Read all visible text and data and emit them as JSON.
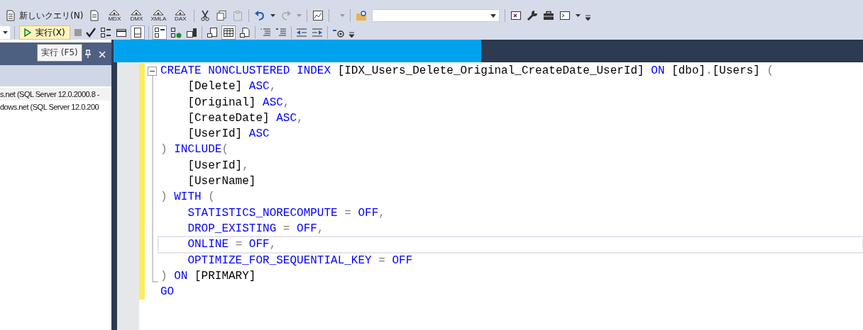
{
  "toolbar_main": {
    "new_query_button": "新しいクエリ(N)",
    "query_type_buttons": [
      "MDX",
      "DMX",
      "XMLA",
      "DAX"
    ]
  },
  "toolbar_sql": {
    "execute_button": "実行(X)"
  },
  "tooltip": "実行 (F5)",
  "object_explorer": {
    "items": [
      {
        "text": "s.net (SQL Server 12.0.2000.8 -",
        "selected": true
      },
      {
        "text": "dows.net (SQL Server 12.0.200",
        "selected": false
      }
    ]
  },
  "editor": {
    "lines": [
      {
        "current": false,
        "tokens": [
          {
            "kind": "keyword",
            "text": "CREATE NONCLUSTERED INDEX"
          },
          {
            "kind": "identifier",
            "text": " [IDX_Users_Delete_Original_CreateDate_UserId] "
          },
          {
            "kind": "keyword",
            "text": "ON"
          },
          {
            "kind": "identifier",
            "text": " [dbo]"
          },
          {
            "kind": "operator",
            "text": "."
          },
          {
            "kind": "identifier",
            "text": "[Users] "
          },
          {
            "kind": "operator",
            "text": "("
          }
        ]
      },
      {
        "current": false,
        "tokens": [
          {
            "kind": "identifier",
            "text": "    [Delete] "
          },
          {
            "kind": "keyword",
            "text": "ASC"
          },
          {
            "kind": "operator",
            "text": ","
          }
        ]
      },
      {
        "current": false,
        "tokens": [
          {
            "kind": "identifier",
            "text": "    [Original] "
          },
          {
            "kind": "keyword",
            "text": "ASC"
          },
          {
            "kind": "operator",
            "text": ","
          }
        ]
      },
      {
        "current": false,
        "tokens": [
          {
            "kind": "identifier",
            "text": "    [CreateDate] "
          },
          {
            "kind": "keyword",
            "text": "ASC"
          },
          {
            "kind": "operator",
            "text": ","
          }
        ]
      },
      {
        "current": false,
        "tokens": [
          {
            "kind": "identifier",
            "text": "    [UserId] "
          },
          {
            "kind": "keyword",
            "text": "ASC"
          }
        ]
      },
      {
        "current": false,
        "tokens": [
          {
            "kind": "operator",
            "text": ") "
          },
          {
            "kind": "keyword",
            "text": "INCLUDE"
          },
          {
            "kind": "operator",
            "text": "("
          }
        ]
      },
      {
        "current": false,
        "tokens": [
          {
            "kind": "identifier",
            "text": "    [UserId]"
          },
          {
            "kind": "operator",
            "text": ","
          }
        ]
      },
      {
        "current": false,
        "tokens": [
          {
            "kind": "identifier",
            "text": "    [UserName]"
          }
        ]
      },
      {
        "current": false,
        "tokens": [
          {
            "kind": "operator",
            "text": ") "
          },
          {
            "kind": "keyword",
            "text": "WITH"
          },
          {
            "kind": "operator",
            "text": " ("
          }
        ]
      },
      {
        "current": false,
        "tokens": [
          {
            "kind": "keyword",
            "text": "    STATISTICS_NORECOMPUTE "
          },
          {
            "kind": "operator",
            "text": "="
          },
          {
            "kind": "keyword",
            "text": " OFF"
          },
          {
            "kind": "operator",
            "text": ","
          }
        ]
      },
      {
        "current": false,
        "tokens": [
          {
            "kind": "keyword",
            "text": "    DROP_EXISTING "
          },
          {
            "kind": "operator",
            "text": "="
          },
          {
            "kind": "keyword",
            "text": " OFF"
          },
          {
            "kind": "operator",
            "text": ","
          }
        ]
      },
      {
        "current": true,
        "tokens": [
          {
            "kind": "keyword",
            "text": "    ONLINE "
          },
          {
            "kind": "operator",
            "text": "="
          },
          {
            "kind": "keyword",
            "text": " OFF"
          },
          {
            "kind": "operator",
            "text": ","
          }
        ]
      },
      {
        "current": false,
        "tokens": [
          {
            "kind": "keyword",
            "text": "    OPTIMIZE_FOR_SEQUENTIAL_KEY "
          },
          {
            "kind": "operator",
            "text": "="
          },
          {
            "kind": "keyword",
            "text": " OFF"
          }
        ]
      },
      {
        "current": false,
        "tokens": [
          {
            "kind": "operator",
            "text": ") "
          },
          {
            "kind": "keyword",
            "text": "ON"
          },
          {
            "kind": "identifier",
            "text": " [PRIMARY]"
          }
        ]
      },
      {
        "current": false,
        "tokens": [
          {
            "kind": "keyword",
            "text": "GO"
          }
        ]
      }
    ]
  }
}
